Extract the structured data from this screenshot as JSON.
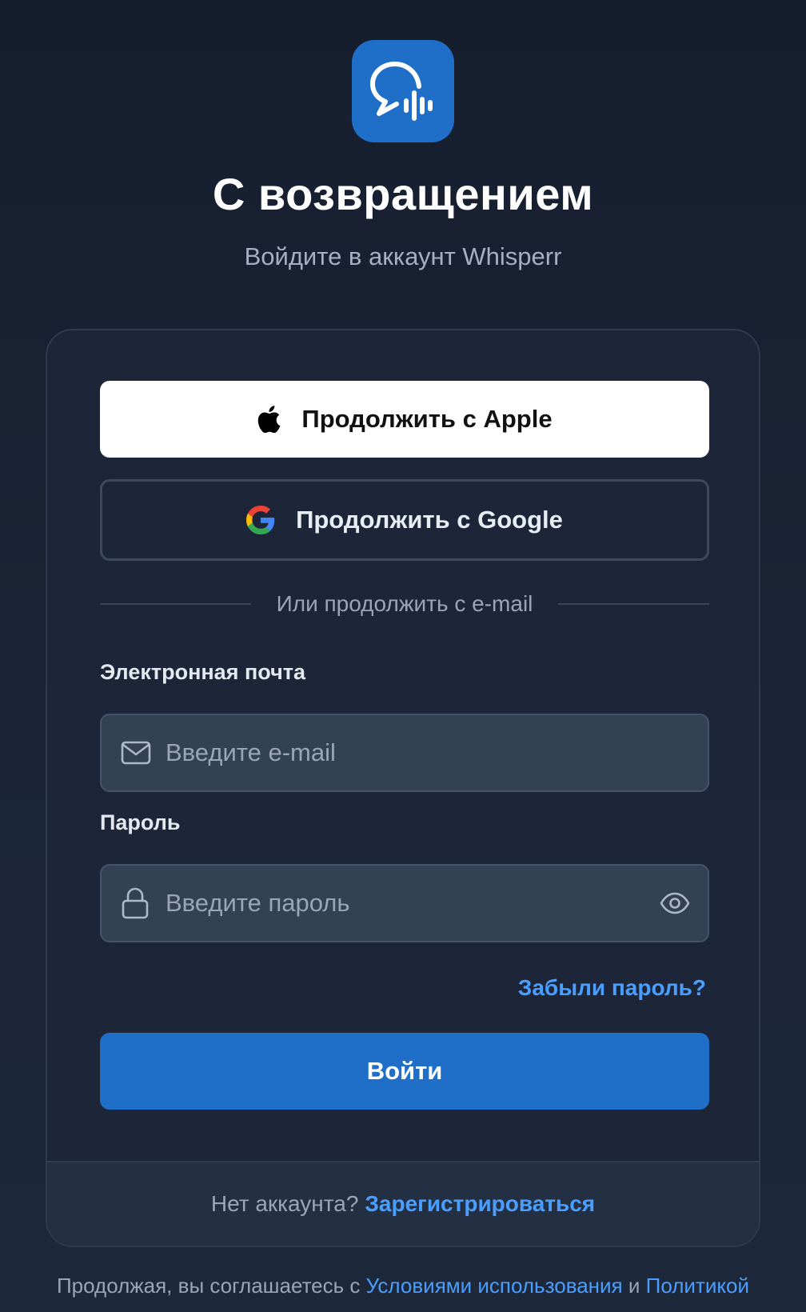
{
  "header": {
    "logo_icon": "chat-bubble-waveform-icon",
    "title": "С возвращением",
    "subtitle": "Войдите в аккаунт Whisperr"
  },
  "social": {
    "apple_label": "Продолжить с Apple",
    "apple_icon": "apple-icon",
    "google_label": "Продолжить с Google",
    "google_icon": "google-icon"
  },
  "divider_text": "Или продолжить с e-mail",
  "form": {
    "email_label": "Электронная почта",
    "email_placeholder": "Введите e-mail",
    "email_value": "",
    "email_icon": "mail-icon",
    "password_label": "Пароль",
    "password_placeholder": "Введите пароль",
    "password_value": "",
    "password_icon": "lock-icon",
    "toggle_icon": "eye-icon",
    "forgot_label": "Забыли пароль?",
    "submit_label": "Войти"
  },
  "footer": {
    "prompt": "Нет аккаунта?",
    "register_label": "Зарегистрироваться"
  },
  "terms": {
    "prefix": "Продолжая, вы соглашаетесь с",
    "terms_link": "Условиями использования",
    "conjunction": "и",
    "privacy_link": "Политикой"
  },
  "colors": {
    "accent": "#1f6fc9",
    "link": "#4a9eff",
    "background": "#1a2333",
    "card": "#1c2638",
    "field": "#334155"
  }
}
